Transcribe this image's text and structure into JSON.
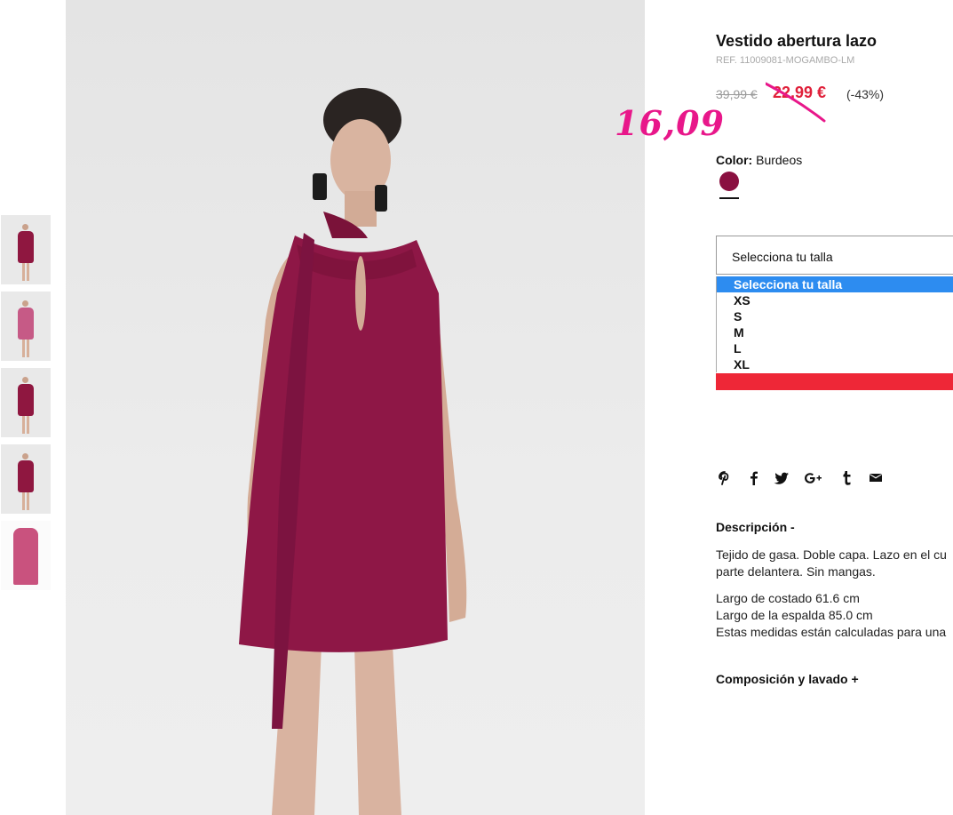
{
  "product": {
    "title": "Vestido abertura lazo",
    "ref": "REF. 11009081-MOGAMBO-LM",
    "old_price": "39,99 €",
    "sale_price": "22,99 €",
    "discount": "(-43%)",
    "handwritten_price": "16,09"
  },
  "color": {
    "label": "Color:",
    "value": "Burdeos",
    "swatch_hex": "#8a1040"
  },
  "size": {
    "placeholder": "Selecciona tu talla",
    "options": [
      "Selecciona tu talla",
      "XS",
      "S",
      "M",
      "L",
      "XL"
    ],
    "selected_index": 0
  },
  "share_icons": [
    "pinterest-icon",
    "facebook-icon",
    "twitter-icon",
    "google-plus-icon",
    "tumblr-icon",
    "email-icon"
  ],
  "description": {
    "heading": "Descripción -",
    "line1": "Tejido de gasa. Doble capa. Lazo en el cu",
    "line2": "parte delantera. Sin mangas.",
    "line3": "Largo de costado 61.6 cm",
    "line4": "Largo de la espalda 85.0 cm",
    "line5": "Estas medidas están calculadas para una"
  },
  "composition": {
    "heading": "Composición y lavado +"
  },
  "colors": {
    "accent_red": "#ee2737",
    "sale_red": "#e0203a",
    "handwritten_pink": "#e8178a",
    "dropdown_highlight": "#2d8cf0"
  }
}
